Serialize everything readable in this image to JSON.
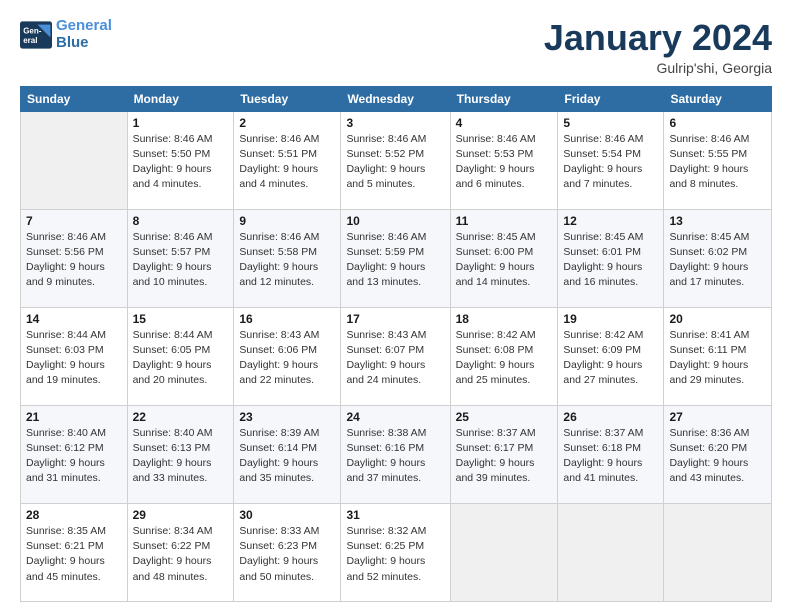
{
  "header": {
    "logo_line1": "General",
    "logo_line2": "Blue",
    "month": "January 2024",
    "location": "Gulrip'shi, Georgia"
  },
  "weekdays": [
    "Sunday",
    "Monday",
    "Tuesday",
    "Wednesday",
    "Thursday",
    "Friday",
    "Saturday"
  ],
  "weeks": [
    [
      {
        "day": "",
        "info": ""
      },
      {
        "day": "1",
        "info": "Sunrise: 8:46 AM\nSunset: 5:50 PM\nDaylight: 9 hours\nand 4 minutes."
      },
      {
        "day": "2",
        "info": "Sunrise: 8:46 AM\nSunset: 5:51 PM\nDaylight: 9 hours\nand 4 minutes."
      },
      {
        "day": "3",
        "info": "Sunrise: 8:46 AM\nSunset: 5:52 PM\nDaylight: 9 hours\nand 5 minutes."
      },
      {
        "day": "4",
        "info": "Sunrise: 8:46 AM\nSunset: 5:53 PM\nDaylight: 9 hours\nand 6 minutes."
      },
      {
        "day": "5",
        "info": "Sunrise: 8:46 AM\nSunset: 5:54 PM\nDaylight: 9 hours\nand 7 minutes."
      },
      {
        "day": "6",
        "info": "Sunrise: 8:46 AM\nSunset: 5:55 PM\nDaylight: 9 hours\nand 8 minutes."
      }
    ],
    [
      {
        "day": "7",
        "info": "Sunrise: 8:46 AM\nSunset: 5:56 PM\nDaylight: 9 hours\nand 9 minutes."
      },
      {
        "day": "8",
        "info": "Sunrise: 8:46 AM\nSunset: 5:57 PM\nDaylight: 9 hours\nand 10 minutes."
      },
      {
        "day": "9",
        "info": "Sunrise: 8:46 AM\nSunset: 5:58 PM\nDaylight: 9 hours\nand 12 minutes."
      },
      {
        "day": "10",
        "info": "Sunrise: 8:46 AM\nSunset: 5:59 PM\nDaylight: 9 hours\nand 13 minutes."
      },
      {
        "day": "11",
        "info": "Sunrise: 8:45 AM\nSunset: 6:00 PM\nDaylight: 9 hours\nand 14 minutes."
      },
      {
        "day": "12",
        "info": "Sunrise: 8:45 AM\nSunset: 6:01 PM\nDaylight: 9 hours\nand 16 minutes."
      },
      {
        "day": "13",
        "info": "Sunrise: 8:45 AM\nSunset: 6:02 PM\nDaylight: 9 hours\nand 17 minutes."
      }
    ],
    [
      {
        "day": "14",
        "info": "Sunrise: 8:44 AM\nSunset: 6:03 PM\nDaylight: 9 hours\nand 19 minutes."
      },
      {
        "day": "15",
        "info": "Sunrise: 8:44 AM\nSunset: 6:05 PM\nDaylight: 9 hours\nand 20 minutes."
      },
      {
        "day": "16",
        "info": "Sunrise: 8:43 AM\nSunset: 6:06 PM\nDaylight: 9 hours\nand 22 minutes."
      },
      {
        "day": "17",
        "info": "Sunrise: 8:43 AM\nSunset: 6:07 PM\nDaylight: 9 hours\nand 24 minutes."
      },
      {
        "day": "18",
        "info": "Sunrise: 8:42 AM\nSunset: 6:08 PM\nDaylight: 9 hours\nand 25 minutes."
      },
      {
        "day": "19",
        "info": "Sunrise: 8:42 AM\nSunset: 6:09 PM\nDaylight: 9 hours\nand 27 minutes."
      },
      {
        "day": "20",
        "info": "Sunrise: 8:41 AM\nSunset: 6:11 PM\nDaylight: 9 hours\nand 29 minutes."
      }
    ],
    [
      {
        "day": "21",
        "info": "Sunrise: 8:40 AM\nSunset: 6:12 PM\nDaylight: 9 hours\nand 31 minutes."
      },
      {
        "day": "22",
        "info": "Sunrise: 8:40 AM\nSunset: 6:13 PM\nDaylight: 9 hours\nand 33 minutes."
      },
      {
        "day": "23",
        "info": "Sunrise: 8:39 AM\nSunset: 6:14 PM\nDaylight: 9 hours\nand 35 minutes."
      },
      {
        "day": "24",
        "info": "Sunrise: 8:38 AM\nSunset: 6:16 PM\nDaylight: 9 hours\nand 37 minutes."
      },
      {
        "day": "25",
        "info": "Sunrise: 8:37 AM\nSunset: 6:17 PM\nDaylight: 9 hours\nand 39 minutes."
      },
      {
        "day": "26",
        "info": "Sunrise: 8:37 AM\nSunset: 6:18 PM\nDaylight: 9 hours\nand 41 minutes."
      },
      {
        "day": "27",
        "info": "Sunrise: 8:36 AM\nSunset: 6:20 PM\nDaylight: 9 hours\nand 43 minutes."
      }
    ],
    [
      {
        "day": "28",
        "info": "Sunrise: 8:35 AM\nSunset: 6:21 PM\nDaylight: 9 hours\nand 45 minutes."
      },
      {
        "day": "29",
        "info": "Sunrise: 8:34 AM\nSunset: 6:22 PM\nDaylight: 9 hours\nand 48 minutes."
      },
      {
        "day": "30",
        "info": "Sunrise: 8:33 AM\nSunset: 6:23 PM\nDaylight: 9 hours\nand 50 minutes."
      },
      {
        "day": "31",
        "info": "Sunrise: 8:32 AM\nSunset: 6:25 PM\nDaylight: 9 hours\nand 52 minutes."
      },
      {
        "day": "",
        "info": ""
      },
      {
        "day": "",
        "info": ""
      },
      {
        "day": "",
        "info": ""
      }
    ]
  ]
}
